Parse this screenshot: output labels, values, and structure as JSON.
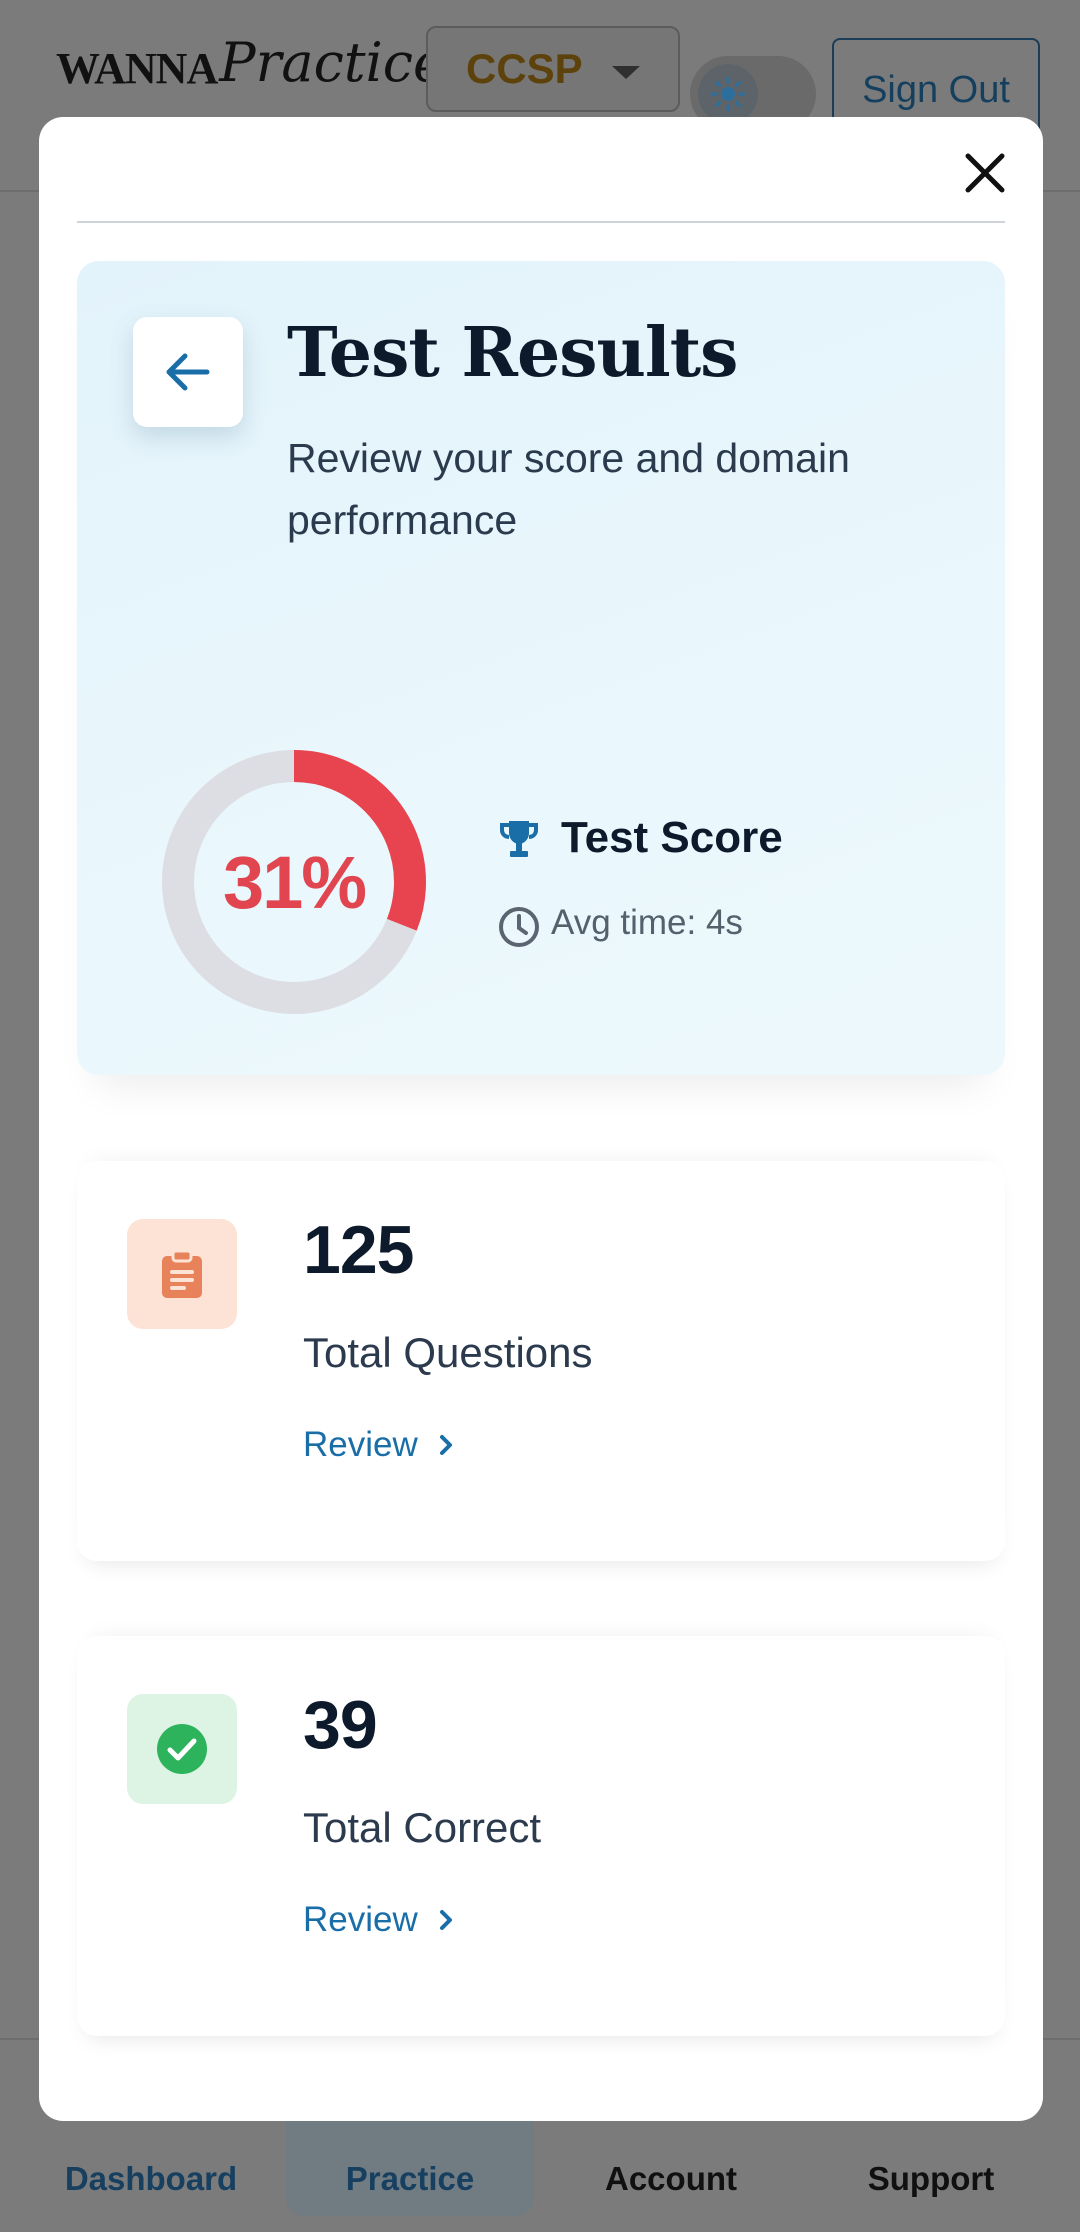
{
  "header": {
    "logo_wanna": "WANNA",
    "logo_practice": "Practice",
    "exam_selected": "CCSP",
    "sign_out_label": "Sign Out"
  },
  "bottom_nav": {
    "items": [
      {
        "label": "Dashboard"
      },
      {
        "label": "Practice",
        "active": true
      },
      {
        "label": "Account"
      },
      {
        "label": "Support"
      }
    ]
  },
  "modal": {
    "title": "Test Results",
    "subtitle": "Review your score and domain performance",
    "score": {
      "percent_label": "31%",
      "percent_value": 31,
      "title": "Test Score",
      "avg_time": "Avg time: 4s"
    },
    "stats": [
      {
        "value": "125",
        "label": "Total Questions",
        "link": "Review",
        "icon": "clipboard-icon"
      },
      {
        "value": "39",
        "label": "Total Correct",
        "link": "Review",
        "icon": "check-circle-icon"
      }
    ]
  },
  "colors": {
    "score_red": "#E8444F",
    "ring_track": "#DCDEE3",
    "accent_blue": "#1A6EA8",
    "clipboard_bg": "#FDE3D6",
    "clipboard_fg": "#E8825A",
    "check_bg": "#DDF4E4",
    "check_fg": "#2DB35C"
  }
}
